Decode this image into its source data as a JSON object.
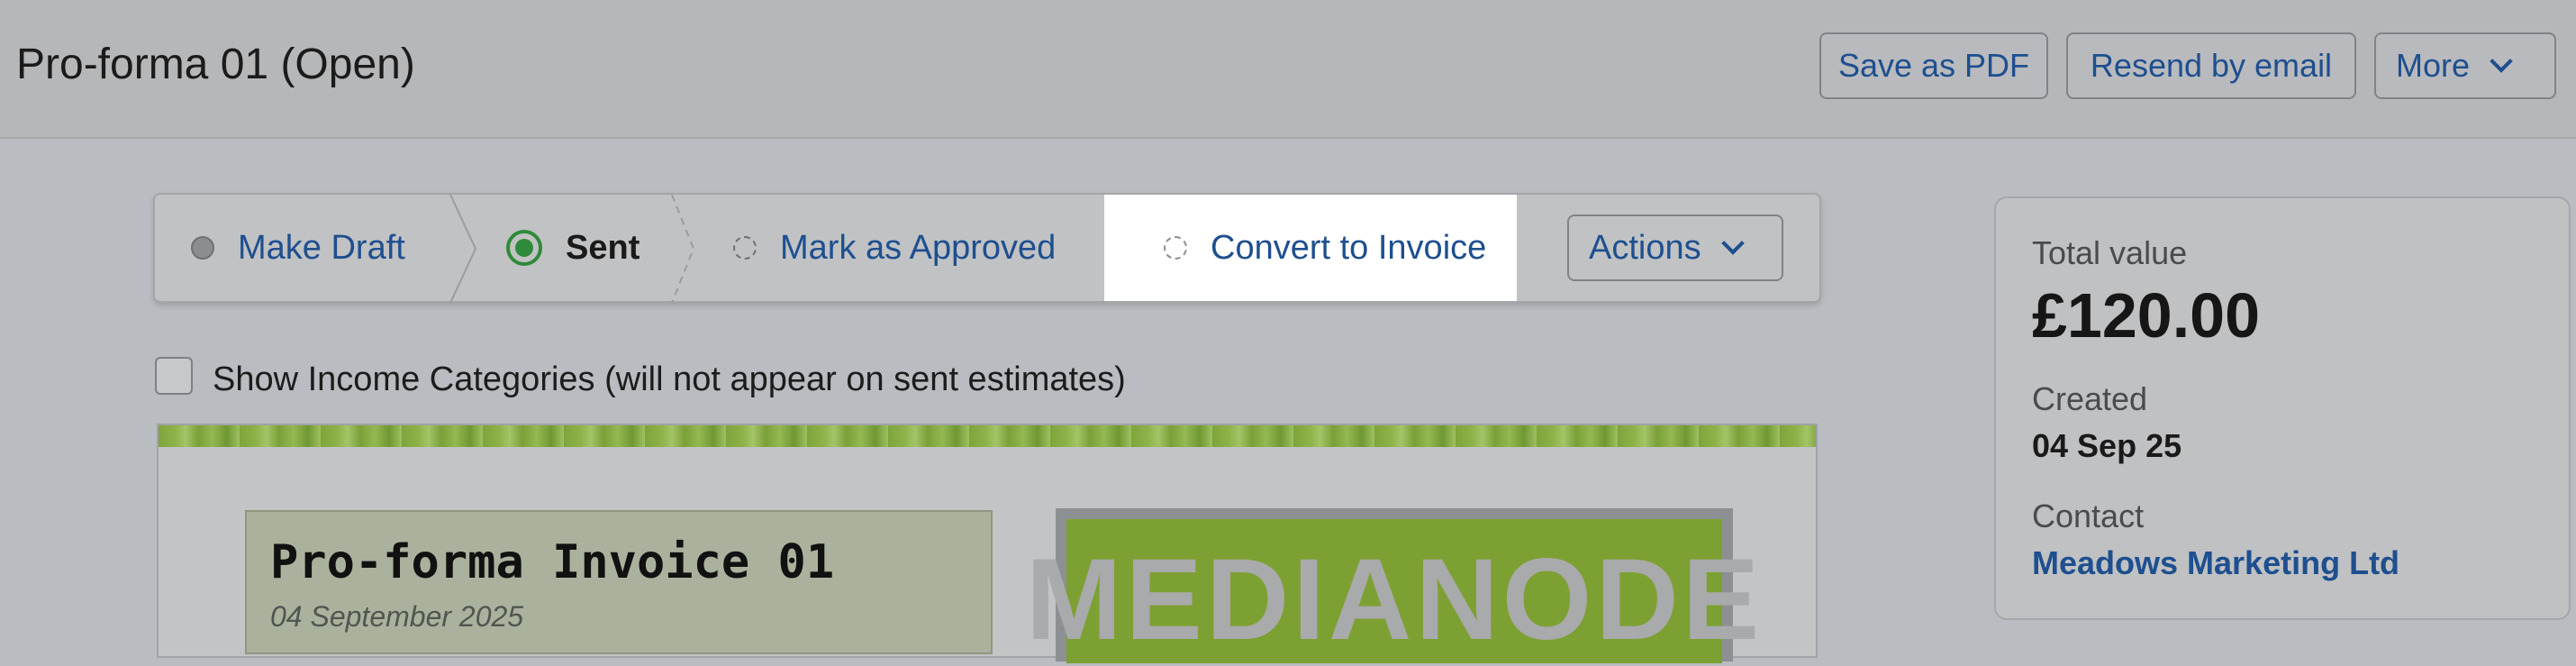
{
  "header": {
    "title": "Pro-forma 01 (Open)",
    "buttons": {
      "save_pdf": "Save as PDF",
      "resend": "Resend by email",
      "more": "More"
    }
  },
  "stepper": {
    "steps": [
      {
        "label": "Make Draft",
        "state": "done"
      },
      {
        "label": "Sent",
        "state": "current"
      },
      {
        "label": "Mark as Approved",
        "state": "pending"
      },
      {
        "label": "Convert to Invoice",
        "state": "pending-highlighted"
      }
    ],
    "actions_label": "Actions"
  },
  "options": {
    "show_income_categories": "Show Income Categories (will not appear on sent estimates)",
    "show_income_categories_checked": false
  },
  "document": {
    "title": "Pro-forma Invoice 01",
    "date": "04 September 2025",
    "logo_text": "MEDIANODE"
  },
  "summary": {
    "total_label": "Total value",
    "total_value": "£120.00",
    "created_label": "Created",
    "created_value": "04 Sep 25",
    "contact_label": "Contact",
    "contact_value": "Meadows Marketing Ltd"
  },
  "colors": {
    "link": "#1e4f8f",
    "sent_green": "#2f8a3b",
    "logo_green": "#7da033"
  }
}
